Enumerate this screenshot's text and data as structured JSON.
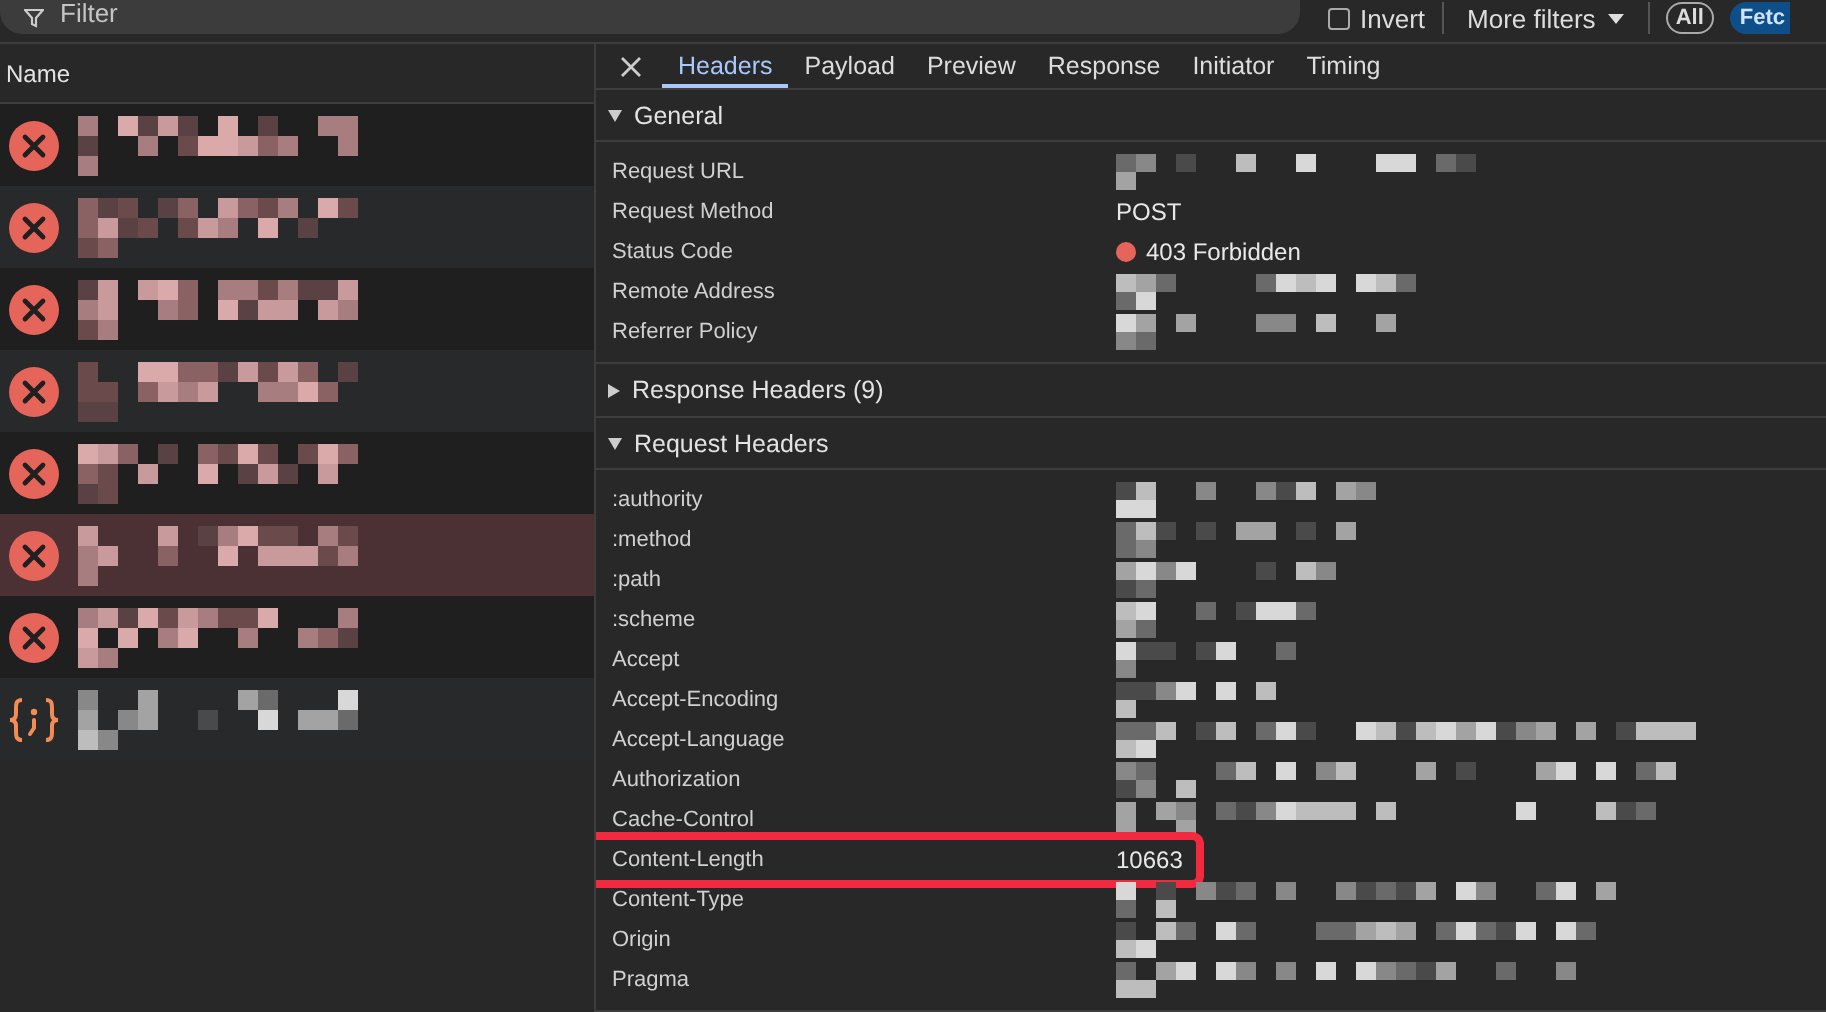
{
  "toolbar": {
    "filter": {
      "placeholder": "Filter"
    },
    "invert": {
      "label": "Invert",
      "checked": false
    },
    "more_filters": "More filters",
    "type_filters": [
      {
        "label": "All",
        "selected": false
      },
      {
        "label": "Fetc",
        "selected": true
      }
    ]
  },
  "request_list": {
    "column": "Name",
    "requests": [
      {
        "kind": "error",
        "selected": false
      },
      {
        "kind": "error",
        "selected": false
      },
      {
        "kind": "error",
        "selected": false
      },
      {
        "kind": "error",
        "selected": false
      },
      {
        "kind": "error",
        "selected": false
      },
      {
        "kind": "error",
        "selected": true
      },
      {
        "kind": "error",
        "selected": false
      },
      {
        "kind": "script",
        "selected": false
      }
    ]
  },
  "details": {
    "tabs": [
      {
        "label": "Headers",
        "selected": true
      },
      {
        "label": "Payload",
        "selected": false
      },
      {
        "label": "Preview",
        "selected": false
      },
      {
        "label": "Response",
        "selected": false
      },
      {
        "label": "Initiator",
        "selected": false
      },
      {
        "label": "Timing",
        "selected": false
      }
    ],
    "sections": [
      {
        "title": "General",
        "expanded": true,
        "rows": [
          {
            "name": "Request URL",
            "redacted": true,
            "highlighted": false
          },
          {
            "name": "Request Method",
            "value": "POST",
            "redacted": false,
            "highlighted": false
          },
          {
            "name": "Status Code",
            "value": "403 Forbidden",
            "color": "#e5655b",
            "redacted": false,
            "highlighted": false
          },
          {
            "name": "Remote Address",
            "redacted": true,
            "highlighted": false
          },
          {
            "name": "Referrer Policy",
            "redacted": true,
            "highlighted": false
          }
        ]
      },
      {
        "title": "Response Headers (9)",
        "expanded": false
      },
      {
        "title": "Request Headers",
        "expanded": true,
        "rows": [
          {
            "name": ":authority",
            "redacted": true,
            "highlighted": false
          },
          {
            "name": ":method",
            "redacted": true,
            "highlighted": false
          },
          {
            "name": ":path",
            "redacted": true,
            "highlighted": false
          },
          {
            "name": ":scheme",
            "redacted": true,
            "highlighted": false
          },
          {
            "name": "Accept",
            "redacted": true,
            "highlighted": false
          },
          {
            "name": "Accept-Encoding",
            "redacted": true,
            "highlighted": false
          },
          {
            "name": "Accept-Language",
            "redacted": true,
            "highlighted": false
          },
          {
            "name": "Authorization",
            "redacted": true,
            "highlighted": false
          },
          {
            "name": "Cache-Control",
            "redacted": true,
            "highlighted": false
          },
          {
            "name": "Content-Length",
            "value": "10663",
            "redacted": false,
            "highlighted": true
          },
          {
            "name": "Content-Type",
            "redacted": true,
            "highlighted": false
          },
          {
            "name": "Origin",
            "redacted": true,
            "highlighted": false
          },
          {
            "name": "Pragma",
            "redacted": true,
            "highlighted": false
          }
        ]
      }
    ]
  }
}
